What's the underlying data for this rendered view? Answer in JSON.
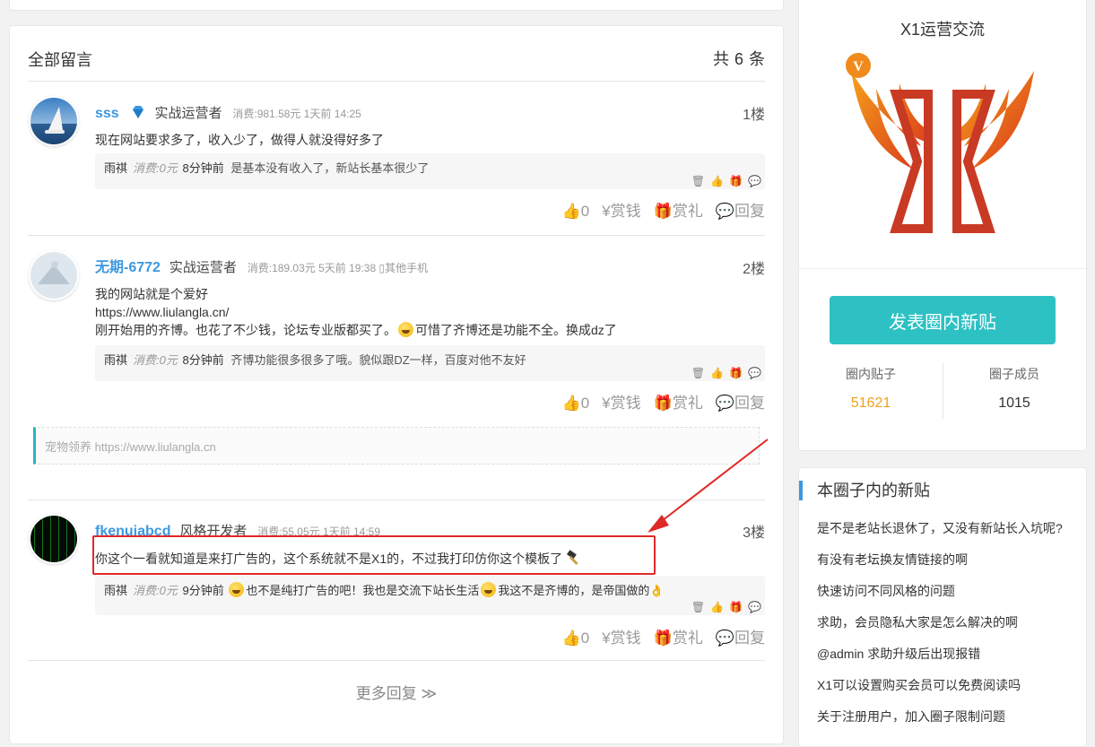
{
  "main": {
    "title": "全部留言",
    "count_prefix": "共",
    "count": "6",
    "count_suffix": "条",
    "more_label": "更多回复 ≫"
  },
  "comments": [
    {
      "username": "sss",
      "role": "实战运营者",
      "consume": "消费:981.58元 1天前 14:25",
      "floor": "1楼",
      "text": "现在网站要求多了，收入少了，做得人就没得好多了",
      "reply": {
        "name": "雨祺",
        "consume": "消费:0元",
        "time": "8分钟前",
        "text": "是基本没有收入了，新站长基本很少了"
      },
      "actions": {
        "like": "👍0",
        "tip": "¥赏钱",
        "gift": "🎁赏礼",
        "reply": "💬回复"
      }
    },
    {
      "username": "无期-6772",
      "role": "实战运营者",
      "consume": "消费:189.03元 5天前 19:38 ▯其他手机",
      "floor": "2楼",
      "line1": "我的网站就是个爱好",
      "line2": "https://www.liulangla.cn/",
      "line3a": "刚开始用的齐博。也花了不少钱，论坛专业版都买了。",
      "line3b": "可惜了齐博还是功能不全。换成dz了",
      "reply": {
        "name": "雨祺",
        "consume": "消费:0元",
        "time": "8分钟前",
        "text": "齐博功能很多很多了哦。貌似跟DZ一样，百度对他不友好"
      },
      "actions": {
        "like": "👍0",
        "tip": "¥赏钱",
        "gift": "🎁赏礼",
        "reply": "💬回复"
      }
    },
    {
      "username": "fkenuiabcd",
      "role": "风格开发者",
      "consume": "消费:55.05元 1天前 14:59",
      "floor": "3楼",
      "text": "你这个一看就知道是来打广告的，这个系统就不是X1的，不过我打印仿你这个模板了",
      "reply": {
        "name": "雨祺",
        "consume": "消费:0元",
        "time": "9分钟前",
        "text_a": "也不是纯打广告的吧！我也是交流下站长生活",
        "text_b": "我这不是齐博的，是帝国做的"
      },
      "actions": {
        "like": "👍0",
        "tip": "¥赏钱",
        "gift": "🎁赏礼",
        "reply": "💬回复"
      }
    }
  ],
  "ad": {
    "text": "宠物领养 https://www.liulangla.cn"
  },
  "reply_icons": {
    "delete": "🗑",
    "like": "👍",
    "gift": "🎁",
    "reply": "💬"
  },
  "sidebar": {
    "group_name": "X1运营交流",
    "logo_letter": "V",
    "post_button": "发表圈内新贴",
    "stats": [
      {
        "label": "圈内贴子",
        "value": "51621"
      },
      {
        "label": "圈子成员",
        "value": "1015"
      }
    ]
  },
  "new_posts": {
    "title": "本圈子内的新贴",
    "items": [
      "是不是老站长退休了，又没有新站长入坑呢?",
      "有没有老坛换友情链接的啊",
      "快速访问不同风格的问题",
      "求助，会员隐私大家是怎么解决的啊",
      "@admin 求助升级后出现报错",
      "X1可以设置购买会员可以免费阅读吗",
      "关于注册用户，加入圈子限制问题"
    ]
  },
  "colors": {
    "accent": "#2ec1c4",
    "link": "#3c98e0",
    "highlight": "#e02828",
    "stat_orange": "#f0a020"
  }
}
